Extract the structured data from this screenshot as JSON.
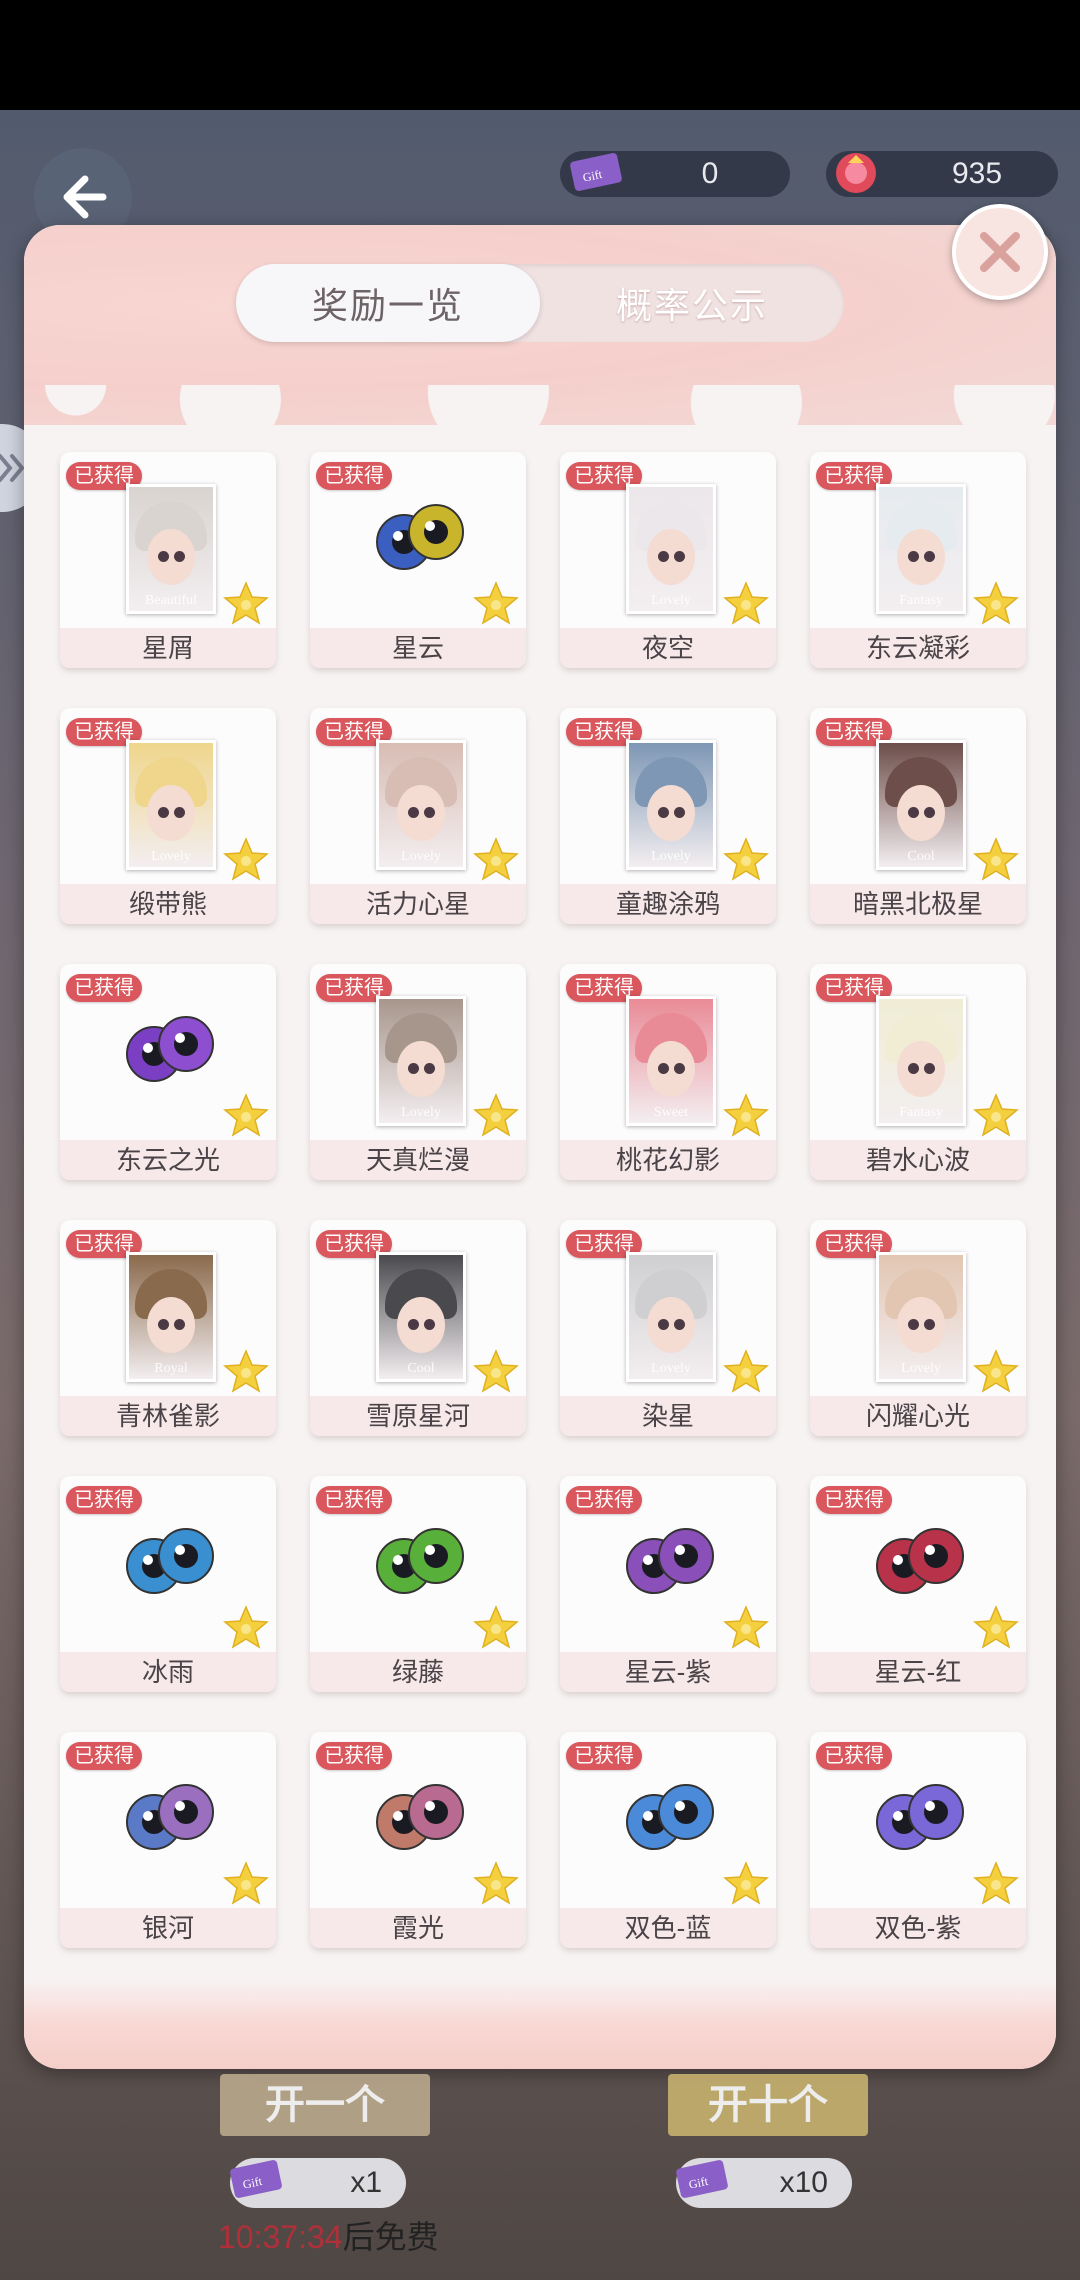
{
  "header": {
    "currency_ticket": "0",
    "currency_gem": "935"
  },
  "tabs": [
    {
      "label": "奖励一览",
      "active": true
    },
    {
      "label": "概率公示",
      "active": false
    }
  ],
  "badge_text": "已获得",
  "items": [
    {
      "name": "星屑",
      "kind": "portrait",
      "caption": "Beautiful",
      "hair": "#d9d4d0"
    },
    {
      "name": "星云",
      "kind": "eyes",
      "c1": "#3b5fc0",
      "c2": "#c9b52c"
    },
    {
      "name": "夜空",
      "kind": "portrait",
      "caption": "Lovely",
      "hair": "#ece7ea"
    },
    {
      "name": "东云凝彩",
      "kind": "portrait",
      "caption": "Fantasy",
      "hair": "#e6ebef"
    },
    {
      "name": "缎带熊",
      "kind": "portrait",
      "caption": "Lovely",
      "hair": "#efd68c"
    },
    {
      "name": "活力心星",
      "kind": "portrait",
      "caption": "Lovely",
      "hair": "#d8bdb4"
    },
    {
      "name": "童趣涂鸦",
      "kind": "portrait",
      "caption": "Lovely",
      "hair": "#7e97b5"
    },
    {
      "name": "暗黑北极星",
      "kind": "portrait",
      "caption": "Cool",
      "hair": "#6d4e4a"
    },
    {
      "name": "东云之光",
      "kind": "eyes",
      "c1": "#7b3fc4",
      "c2": "#8d4ed0"
    },
    {
      "name": "天真烂漫",
      "kind": "portrait",
      "caption": "Lovely",
      "hair": "#a7968c"
    },
    {
      "name": "桃花幻影",
      "kind": "portrait",
      "caption": "Sweet",
      "hair": "#e98b97"
    },
    {
      "name": "碧水心波",
      "kind": "portrait",
      "caption": "Fantasy",
      "hair": "#f0edd4"
    },
    {
      "name": "青林雀影",
      "kind": "portrait",
      "caption": "Royal",
      "hair": "#8a6a4c"
    },
    {
      "name": "雪原星河",
      "kind": "portrait",
      "caption": "Cool",
      "hair": "#4a4a4e"
    },
    {
      "name": "染星",
      "kind": "portrait",
      "caption": "Lovely",
      "hair": "#cfcfd2"
    },
    {
      "name": "闪耀心光",
      "kind": "portrait",
      "caption": "Lovely",
      "hair": "#e2c6b2"
    },
    {
      "name": "冰雨",
      "kind": "eyes",
      "c1": "#3a8fd0",
      "c2": "#3a8fd0"
    },
    {
      "name": "绿藤",
      "kind": "eyes",
      "c1": "#58b03a",
      "c2": "#58b03a"
    },
    {
      "name": "星云-紫",
      "kind": "eyes",
      "c1": "#8a4fb8",
      "c2": "#8a4fb8"
    },
    {
      "name": "星云-红",
      "kind": "eyes",
      "c1": "#b8324a",
      "c2": "#b8324a"
    },
    {
      "name": "银河",
      "kind": "eyes",
      "c1": "#5a7ac8",
      "c2": "#9a6fc0"
    },
    {
      "name": "霞光",
      "kind": "eyes",
      "c1": "#c07a6a",
      "c2": "#b86a90"
    },
    {
      "name": "双色-蓝",
      "kind": "eyes",
      "c1": "#4a8ad8",
      "c2": "#4a8ad8"
    },
    {
      "name": "双色-紫",
      "kind": "eyes",
      "c1": "#7a68d8",
      "c2": "#7a68d8"
    }
  ],
  "footer": {
    "open_one": "开一个",
    "open_ten": "开十个",
    "cost_one": "x1",
    "cost_ten": "x10",
    "timer_time": "10:37:34",
    "timer_suffix": "后免费"
  }
}
